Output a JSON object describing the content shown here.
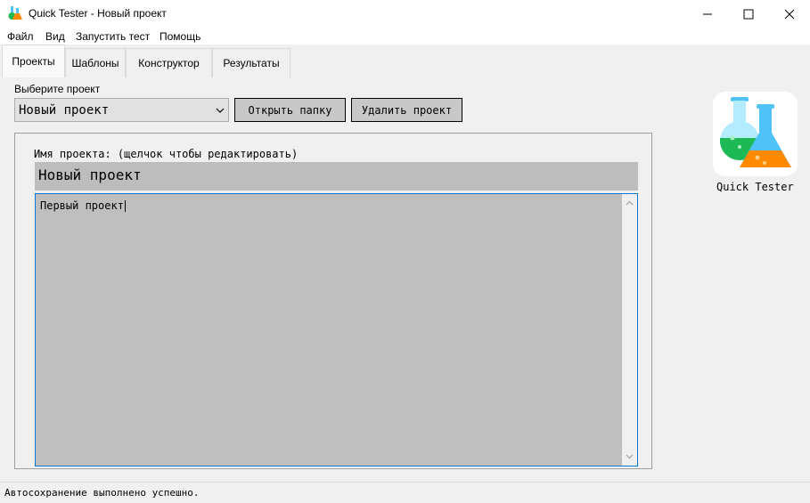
{
  "window": {
    "title": "Quick Tester - Новый проект"
  },
  "menu": [
    "Файл",
    "Вид",
    "Запустить тест",
    "Помощь"
  ],
  "tabs": [
    "Проекты",
    "Шаблоны",
    "Конструктор",
    "Результаты"
  ],
  "projects": {
    "select_label": "Выберите проект",
    "selected_project": "Новый проект",
    "open_folder_label": "Открыть папку",
    "delete_project_label": "Удалить проект",
    "name_label": "Имя проекта: (щелчок чтобы редактировать)",
    "name_value": "Новый проект",
    "description_text": "Первый проект"
  },
  "logo": {
    "label": "Quick Tester"
  },
  "status": {
    "text": "Автосохранение выполнено успешно."
  },
  "colors": {
    "accent_border": "#0078d7",
    "flask_green": "#1db954",
    "flask_orange": "#ff8a00",
    "flask_blue": "#4fc3f7"
  }
}
